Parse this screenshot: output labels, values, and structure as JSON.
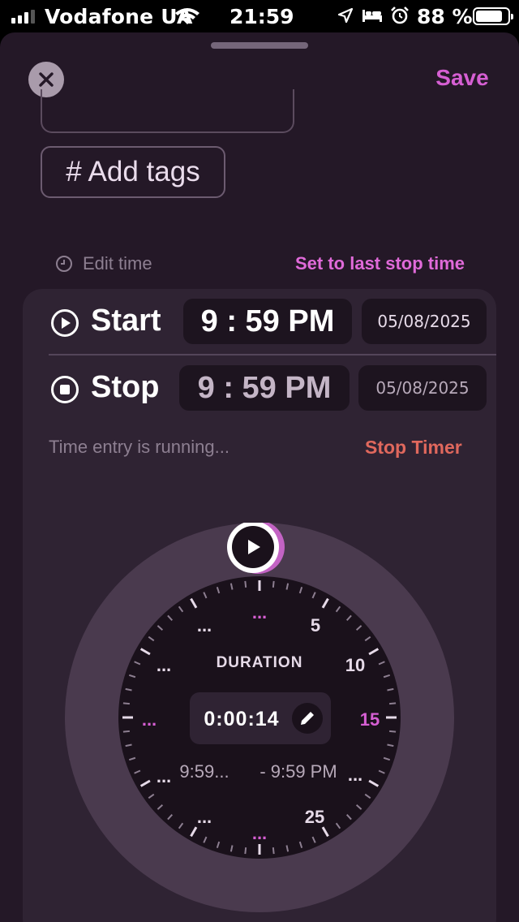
{
  "status_bar": {
    "carrier": "Vodafone UA",
    "time": "21:59",
    "battery_percent": "88 %",
    "battery_level": 0.88,
    "icons": [
      "signal-icon",
      "wifi-icon",
      "location-arrow-icon",
      "bed-icon",
      "alarm-icon",
      "battery-icon"
    ]
  },
  "header": {
    "close_icon": "close-icon",
    "save_label": "Save"
  },
  "tags": {
    "label": "# Add tags"
  },
  "edit_time": {
    "label": "Edit time",
    "icon": "clock-icon",
    "last_stop_label": "Set to last stop time"
  },
  "start": {
    "label": "Start",
    "icon": "play-circle-icon",
    "time": "9 : 59 PM",
    "date": "05/08/2025"
  },
  "stop": {
    "label": "Stop",
    "icon": "stop-circle-icon",
    "time": "9 : 59 PM",
    "date": "05/08/2025"
  },
  "running": {
    "text": "Time entry is running...",
    "stop_timer_label": "Stop Timer"
  },
  "dial": {
    "duration_label": "DURATION",
    "duration_value": "0:00:14",
    "range_start": "9:59...",
    "range_end": "- 9:59 PM",
    "marks": [
      "...",
      "5",
      "10",
      "15",
      "...",
      "25",
      "...",
      "...",
      "...",
      "...",
      "...",
      "..."
    ],
    "edit_icon": "pencil-icon",
    "handle_icon": "play-icon"
  },
  "colors": {
    "accent": "#d65fd3",
    "danger": "#e0685d",
    "sheet_bg": "#241827",
    "card_bg": "#2f2333"
  }
}
